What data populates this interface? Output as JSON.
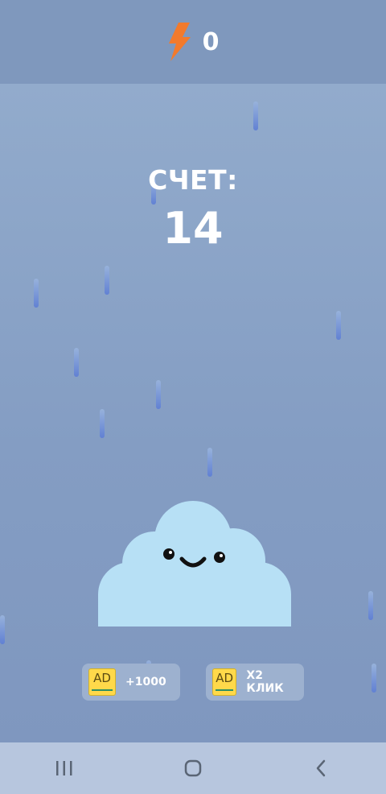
{
  "top_bar": {
    "energy_icon": "lightning-bolt-icon",
    "energy_count": "0",
    "accent_color": "#f27a2c"
  },
  "score": {
    "label": "СЧЕТ:",
    "value": "14"
  },
  "character": {
    "name": "cloud",
    "color": "#b7e0f5"
  },
  "ad_buttons": [
    {
      "badge": "AD",
      "label": "+1000"
    },
    {
      "badge": "AD",
      "label": "X2 КЛИК"
    }
  ],
  "navigation": {
    "recent_icon": "recent-apps-icon",
    "home_icon": "home-icon",
    "back_icon": "back-icon"
  }
}
